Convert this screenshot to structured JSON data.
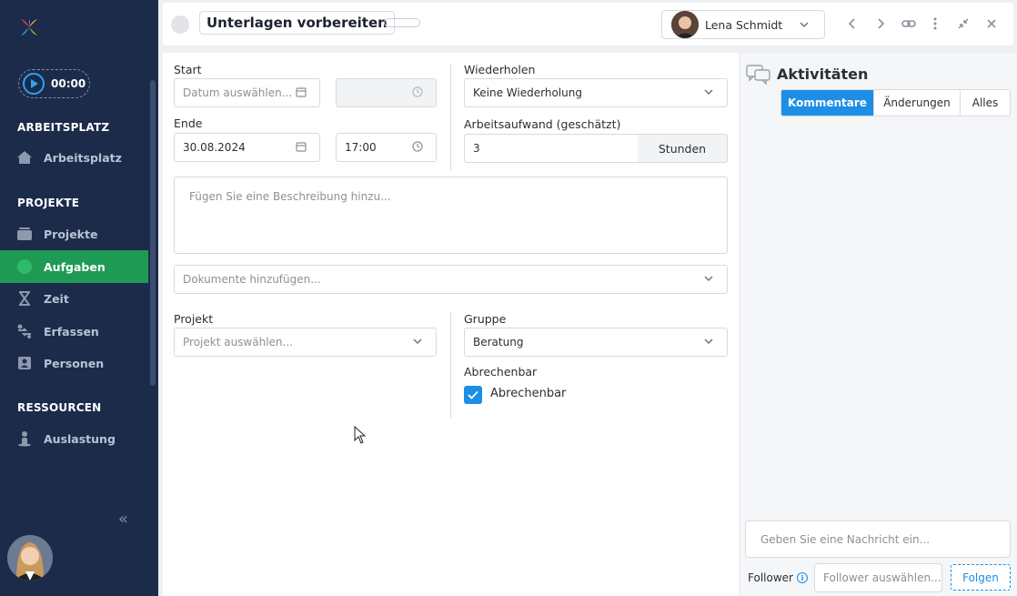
{
  "sidebar": {
    "timer": "00:00",
    "sections": [
      {
        "title": "ARBEITSPLATZ"
      },
      {
        "title": "PROJEKTE"
      },
      {
        "title": "RESSOURCEN"
      }
    ],
    "items": [
      {
        "label": "Arbeitsplatz",
        "icon": "home-icon"
      },
      {
        "label": "Projekte",
        "icon": "folder-icon"
      },
      {
        "label": "Aufgaben",
        "icon": "circle-icon",
        "active": true
      },
      {
        "label": "Zeit",
        "icon": "hourglass-icon"
      },
      {
        "label": "Erfassen",
        "icon": "transfer-icon"
      },
      {
        "label": "Personen",
        "icon": "contact-icon"
      },
      {
        "label": "Auslastung",
        "icon": "person-load-icon"
      }
    ]
  },
  "header": {
    "title": "Unterlagen vorbereiten",
    "user": "Lena Schmidt"
  },
  "form": {
    "start_label": "Start",
    "start_date_placeholder": "Datum auswählen...",
    "end_label": "Ende",
    "end_date": "30.08.2024",
    "end_time": "17:00",
    "repeat_label": "Wiederholen",
    "repeat_value": "Keine Wiederholung",
    "effort_label": "Arbeitsaufwand (geschätzt)",
    "effort_value": "3",
    "effort_unit": "Stunden",
    "description_placeholder": "Fügen Sie eine Beschreibung hinzu...",
    "documents_placeholder": "Dokumente hinzufügen...",
    "project_label": "Projekt",
    "project_placeholder": "Projekt auswählen...",
    "group_label": "Gruppe",
    "group_value": "Beratung",
    "billable_label": "Abrechenbar",
    "billable_checkbox_label": "Abrechenbar",
    "billable_checked": true
  },
  "activities": {
    "title": "Aktivitäten",
    "tabs": [
      {
        "label": "Kommentare",
        "active": true
      },
      {
        "label": "Änderungen"
      },
      {
        "label": "Alles"
      }
    ],
    "message_placeholder": "Geben Sie eine Nachricht ein...",
    "follower_label": "Follower",
    "follower_placeholder": "Follower auswählen...",
    "follow_button": "Folgen"
  },
  "colors": {
    "sidebar_bg": "#1c2b4a",
    "active_green": "#1f9a55",
    "accent_blue": "#1d8ee6"
  }
}
